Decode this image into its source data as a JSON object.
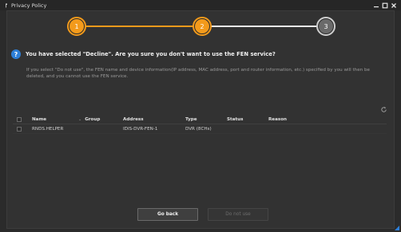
{
  "window": {
    "title": "Privacy Policy",
    "minimize_icon": "minimize-icon",
    "maximize_icon": "maximize-icon",
    "close_icon": "close-icon"
  },
  "stepper": {
    "steps": [
      "1",
      "2",
      "3"
    ],
    "current_step": 2,
    "accent_color": "#f39a1b"
  },
  "question": {
    "icon": "question-icon",
    "text": "You have selected \"Decline\". Are you sure you don't want to use the FEN service?"
  },
  "description": "If you select \"Do not use\", the FEN name and device information(IP address, MAC address, port and router information, etc.) specified by you will then be deleted, and you cannot use the FEN service.",
  "table": {
    "columns": {
      "name": "Name",
      "group": "Group",
      "address": "Address",
      "type": "Type",
      "status": "Status",
      "reason": "Reason"
    },
    "rows": [
      {
        "name": "RNDS.HELPER",
        "group": "",
        "address": "IDIS-DVR-FEN-1",
        "type": "DVR (8CHs)",
        "status": "",
        "reason": ""
      }
    ]
  },
  "buttons": {
    "go_back": "Go back",
    "do_not_use": "Do not use"
  }
}
